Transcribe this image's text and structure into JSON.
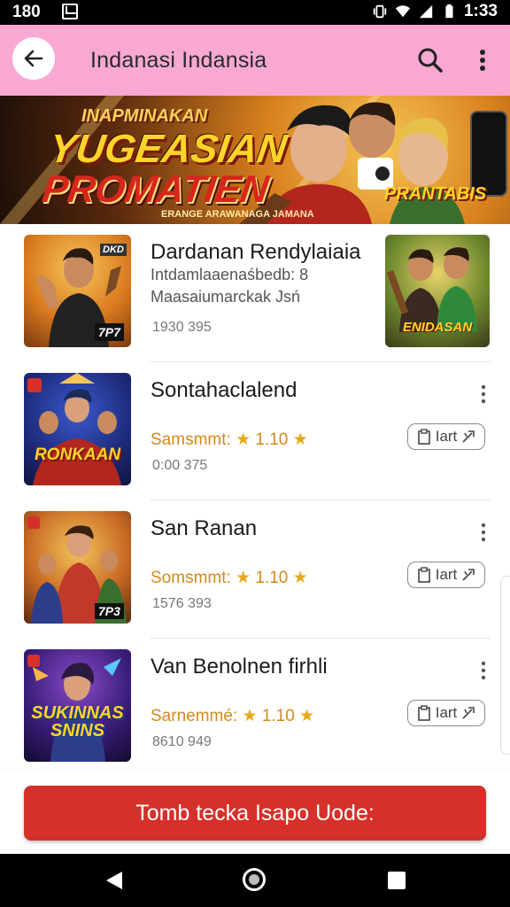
{
  "status_bar": {
    "time_left": "180",
    "time_right": "1:33"
  },
  "app_bar": {
    "title": "Indanasi Indansia"
  },
  "banner": {
    "line1": "INAPMINAKAN",
    "line2": "YUGEASIAN",
    "line3": "PROMATIEN",
    "caption": "ERANGE ARAWANAGA JAMANA",
    "side_text": "PRANTABIS"
  },
  "items": [
    {
      "name": "Dardanan Rendylaiaia",
      "desc1": "Intdamlaaenaśbedb: 8",
      "desc2": "Maasaiumarckak Jsń",
      "meta": "1930  395",
      "thumb_tag": "7P7",
      "side_pic_label": "ENIDASAN"
    },
    {
      "name": "Sontahaclalend",
      "rating_label": "Samsmmt:",
      "rating_value": "1.10",
      "meta": "0:00  375",
      "button_label": "Iart",
      "thumb_tag": "RONKAAN"
    },
    {
      "name": "San Ranan",
      "rating_label": "Somsmmt:",
      "rating_value": "1.10",
      "meta": "1576  393",
      "button_label": "Iart",
      "thumb_tag": "7P3"
    },
    {
      "name": "Van Benolnen firhli",
      "rating_label": "Sarnemmé:",
      "rating_value": "1.10",
      "meta": "8610  949",
      "button_label": "Iart",
      "thumb_tag": "SUKINNAS SNINS"
    }
  ],
  "cta": {
    "label": "Tomb tecka Isapo Uode:"
  },
  "colors": {
    "appbar": "#f9a8d4",
    "cta": "#d6302a",
    "rating": "#d3891d"
  }
}
